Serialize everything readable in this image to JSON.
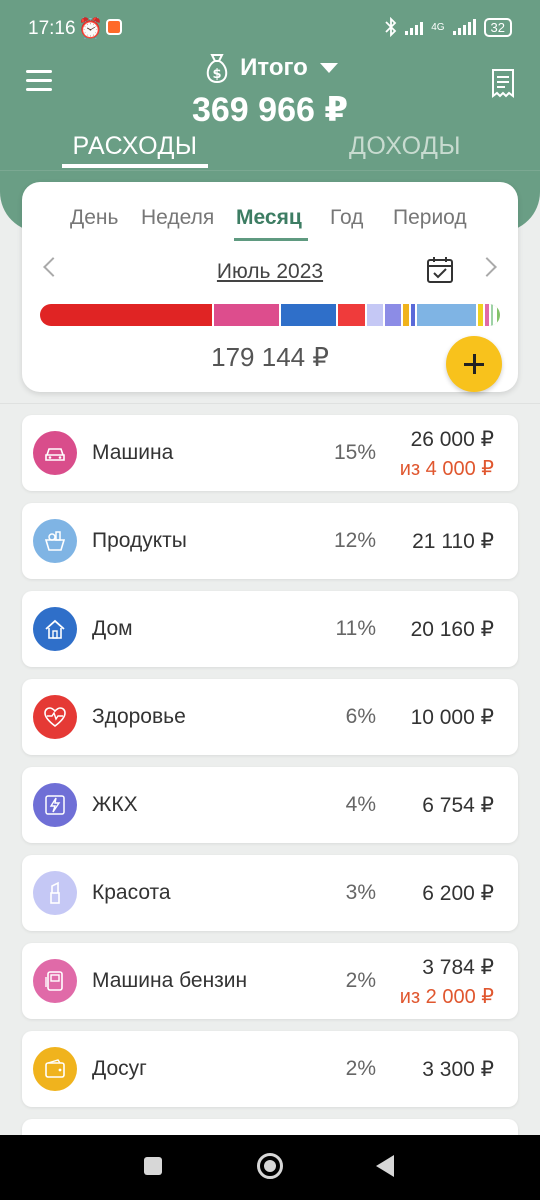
{
  "status": {
    "time": "17:16",
    "network": "4G",
    "battery": "32"
  },
  "header": {
    "account_title": "Итого",
    "total": "369 966 ₽",
    "tabs": [
      {
        "label": "РАСХОДЫ"
      },
      {
        "label": "ДОХОДЫ"
      }
    ]
  },
  "summary": {
    "period_tabs": [
      {
        "label": "День"
      },
      {
        "label": "Неделя"
      },
      {
        "label": "Месяц"
      },
      {
        "label": "Год"
      },
      {
        "label": "Период"
      }
    ],
    "active_period": "Месяц",
    "month": "Июль 2023",
    "total": "179 144 ₽",
    "bar_segments": [
      {
        "color": "#e02424",
        "value": 26000
      },
      {
        "color": "#dd4d8d",
        "value": 10000
      },
      {
        "color": "#2f6fc9",
        "value": 8500
      },
      {
        "color": "#ef3b3b",
        "value": 4200
      },
      {
        "color": "#c5c8f5",
        "value": 2700
      },
      {
        "color": "#8c8ce6",
        "value": 2700
      },
      {
        "color": "#f0b31d",
        "value": 1200
      },
      {
        "color": "#5a6ad9",
        "value": 1000
      },
      {
        "color": "#7fb4e4",
        "value": 9000
      },
      {
        "color": "#f0d21f",
        "value": 1000
      },
      {
        "color": "#e06aa8",
        "value": 1000
      },
      {
        "color": "#9ed2a5",
        "value": 500
      },
      {
        "color": "#d8a850",
        "value": 400
      },
      {
        "color": "#84c26a",
        "value": 400
      }
    ]
  },
  "categories": [
    {
      "name": "Машина",
      "percent": "15%",
      "amount": "26 000 ₽",
      "budget": "из 4 000 ₽",
      "color": "#d94d8b",
      "icon": "car-icon"
    },
    {
      "name": "Продукты",
      "percent": "12%",
      "amount": "21 110 ₽",
      "budget": "",
      "color": "#7fb4e4",
      "icon": "grocery-basket-icon"
    },
    {
      "name": "Дом",
      "percent": "11%",
      "amount": "20 160 ₽",
      "budget": "",
      "color": "#2f6fc9",
      "icon": "house-icon"
    },
    {
      "name": "Здоровье",
      "percent": "6%",
      "amount": "10 000 ₽",
      "budget": "",
      "color": "#e53935",
      "icon": "heart-pulse-icon"
    },
    {
      "name": "ЖКХ",
      "percent": "4%",
      "amount": "6 754 ₽",
      "budget": "",
      "color": "#6f6fd6",
      "icon": "utility-bolt-icon"
    },
    {
      "name": "Красота",
      "percent": "3%",
      "amount": "6 200 ₽",
      "budget": "",
      "color": "#c5c8f5",
      "icon": "lipstick-icon"
    },
    {
      "name": "Машина бензин",
      "percent": "2%",
      "amount": "3 784 ₽",
      "budget": "из 2 000 ₽",
      "color": "#e06aa8",
      "icon": "fuel-icon"
    },
    {
      "name": "Досуг",
      "percent": "2%",
      "amount": "3 300 ₽",
      "budget": "",
      "color": "#f0b31d",
      "icon": "wallet-icon"
    }
  ]
}
